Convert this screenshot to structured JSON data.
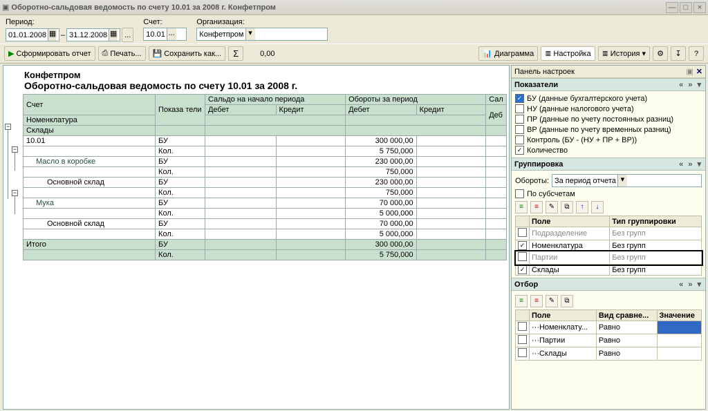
{
  "window": {
    "title": "Оборотно-сальдовая ведомость по счету 10.01 за 2008 г. Конфетпром"
  },
  "filters": {
    "period_label": "Период:",
    "date_from": "01.01.2008",
    "date_to": "31.12.2008",
    "account_label": "Счет:",
    "account": "10.01",
    "org_label": "Организация:",
    "org": "Конфетпром"
  },
  "toolbar": {
    "run": "Сформировать отчет",
    "print": "Печать...",
    "save": "Сохранить как...",
    "sum_value": "0,00",
    "diagram": "Диаграмма",
    "settings": "Настройка",
    "history": "История"
  },
  "report": {
    "company": "Конфетпром",
    "title": "Оборотно-сальдовая ведомость по счету 10.01 за 2008 г.",
    "head": {
      "c0": "Счет",
      "c1": "Показа\nтели",
      "g1": "Сальдо на начало периода",
      "g2": "Обороты за период",
      "g3": "Сал",
      "d": "Дебет",
      "k": "Кредит",
      "d2": "Деб",
      "r2a": "Номенклатура",
      "r2b": "Склады"
    },
    "rows": [
      {
        "n": "10.01",
        "p": "БУ",
        "v": "300 000,00"
      },
      {
        "n": "",
        "p": "Кол.",
        "v": "5 750,000"
      },
      {
        "n": "Масло в коробке",
        "p": "БУ",
        "v": "230 000,00",
        "cls": "indent1"
      },
      {
        "n": "",
        "p": "Кол.",
        "v": "750,000"
      },
      {
        "n": "Основной склад",
        "p": "БУ",
        "v": "230 000,00",
        "cls": "indent2"
      },
      {
        "n": "",
        "p": "Кол.",
        "v": "750,000"
      },
      {
        "n": "Мука",
        "p": "БУ",
        "v": "70 000,00",
        "cls": "indent1"
      },
      {
        "n": "",
        "p": "Кол.",
        "v": "5 000,000"
      },
      {
        "n": "Основной склад",
        "p": "БУ",
        "v": "70 000,00",
        "cls": "indent2"
      },
      {
        "n": "",
        "p": "Кол.",
        "v": "5 000,000"
      }
    ],
    "total": {
      "n": "Итого",
      "bu": "БУ",
      "v1": "300 000,00",
      "kol": "Кол.",
      "v2": "5 750,000"
    }
  },
  "settings": {
    "panel_title": "Панель настроек",
    "pokazateli": {
      "title": "Показатели",
      "items": [
        {
          "chk": true,
          "blue": true,
          "label": "БУ (данные бухгалтерского учета)"
        },
        {
          "chk": false,
          "label": "НУ (данные налогового учета)"
        },
        {
          "chk": false,
          "label": "ПР (данные по учету постоянных разниц)"
        },
        {
          "chk": false,
          "label": "ВР (данные по учету временных разниц)"
        },
        {
          "chk": false,
          "label": "Контроль (БУ - (НУ + ПР + ВР))"
        },
        {
          "chk": true,
          "label": "Количество"
        }
      ]
    },
    "group": {
      "title": "Группировка",
      "turn_label": "Обороты:",
      "turn_value": "За период отчета",
      "sub_label": "По субсчетам",
      "cols": {
        "c1": "Поле",
        "c2": "Тип группировки"
      },
      "rows": [
        {
          "chk": false,
          "gray": true,
          "f": "Подразделение",
          "t": "Без групп"
        },
        {
          "chk": true,
          "f": "Номенклатура",
          "t": "Без групп"
        },
        {
          "chk": false,
          "gray": true,
          "sel": true,
          "f": "Партии",
          "t": "Без групп"
        },
        {
          "chk": true,
          "f": "Склады",
          "t": "Без групп"
        }
      ]
    },
    "filter": {
      "title": "Отбор",
      "cols": {
        "c1": "Поле",
        "c2": "Вид сравне...",
        "c3": "Значение"
      },
      "rows": [
        {
          "f": "Номенклату...",
          "c": "Равно",
          "sel": true
        },
        {
          "f": "Партии",
          "c": "Равно"
        },
        {
          "f": "Склады",
          "c": "Равно"
        }
      ]
    }
  }
}
